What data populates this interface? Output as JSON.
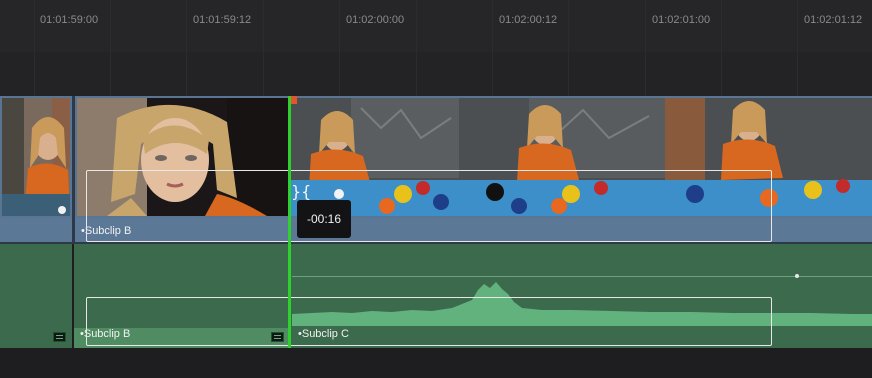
{
  "ruler": {
    "ticks": [
      "01:01:59:00",
      "01:01:59:12",
      "01:02:00:00",
      "01:02:00:12",
      "01:02:01:00",
      "01:02:01:12"
    ]
  },
  "video_track": {
    "clips": [
      {
        "name": ""
      },
      {
        "name": "Subclip B"
      },
      {
        "name": ""
      }
    ]
  },
  "audio_track": {
    "clips": [
      {
        "name": "Subclip B"
      },
      {
        "name": "Subclip C"
      }
    ]
  },
  "playhead": {
    "tooltip": "-00:16"
  },
  "colors": {
    "video_clip": "#5a7594",
    "audio_track": "#3c6a4c",
    "playhead": "#2fd12f",
    "playhead_marker": "#e6552a",
    "waveform": "#62b27e"
  },
  "icons": [
    "audio-clip-icon",
    "trim-bracket-icon"
  ]
}
